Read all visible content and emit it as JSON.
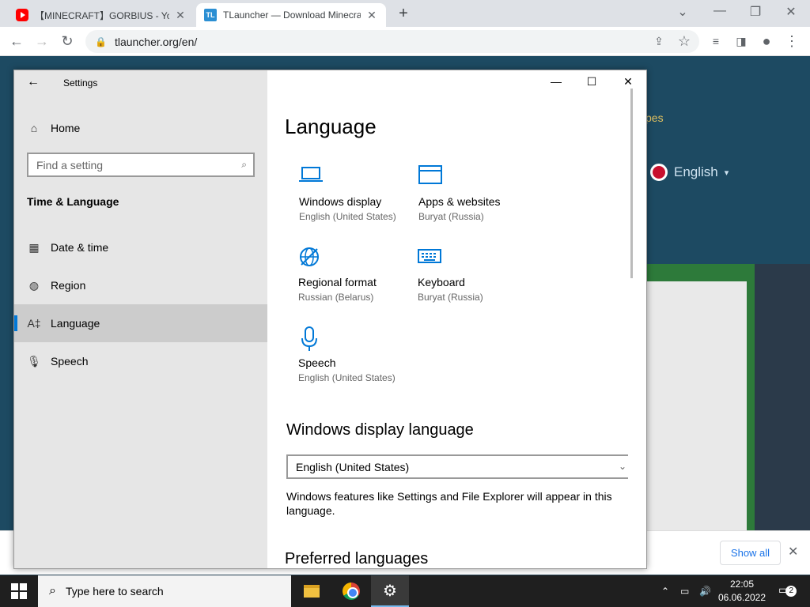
{
  "browser": {
    "tabs": [
      {
        "title": "【MINECRAFT】GORBIUS - YouTube"
      },
      {
        "title": "TLauncher — Download Minecraft"
      }
    ],
    "tab2_favicon": "TL",
    "url": "tlauncher.org/en/"
  },
  "page_behind": {
    "pipes_text": "pes",
    "language": "English"
  },
  "download_bar": {
    "show_all": "Show all"
  },
  "settings": {
    "title": "Settings",
    "home": "Home",
    "search_placeholder": "Find a setting",
    "section": "Time & Language",
    "nav": [
      {
        "label": "Date & time",
        "icon": "calendar-clock-icon"
      },
      {
        "label": "Region",
        "icon": "globe-icon"
      },
      {
        "label": "Language",
        "icon": "language-icon"
      },
      {
        "label": "Speech",
        "icon": "microphone-icon"
      }
    ],
    "heading": "Language",
    "tiles": [
      {
        "name": "Windows display",
        "sub": "English (United States)",
        "icon": "monitor-icon"
      },
      {
        "name": "Apps & websites",
        "sub": "Buryat (Russia)",
        "icon": "window-icon"
      },
      {
        "name": "Regional format",
        "sub": "Russian (Belarus)",
        "icon": "globe-format-icon"
      },
      {
        "name": "Keyboard",
        "sub": "Buryat (Russia)",
        "icon": "keyboard-icon"
      },
      {
        "name": "Speech",
        "sub": "English (United States)",
        "icon": "microphone-icon"
      }
    ],
    "display_language_heading": "Windows display language",
    "display_language_value": "English (United States)",
    "display_language_desc": "Windows features like Settings and File Explorer will appear in this language.",
    "preferred_heading": "Preferred languages"
  },
  "taskbar": {
    "search_placeholder": "Type here to search",
    "time": "22:05",
    "date": "06.06.2022",
    "notifications": "2"
  },
  "colors": {
    "accent": "#0078d7",
    "taskbar": "#1f1f1f"
  }
}
